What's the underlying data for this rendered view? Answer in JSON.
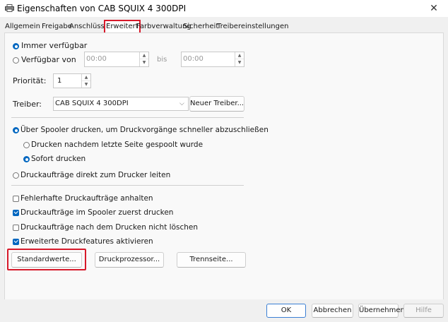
{
  "window": {
    "title": "Eigenschaften von CAB SQUIX 4 300DPI",
    "close_glyph": "✕"
  },
  "tabs": [
    {
      "label": "Allgemein"
    },
    {
      "label": "Freigabe"
    },
    {
      "label": "Anschlüsse"
    },
    {
      "label": "Erweitert"
    },
    {
      "label": "Farbverwaltung"
    },
    {
      "label": "Sicherheit"
    },
    {
      "label": "Treibereinstellungen"
    }
  ],
  "active_tab": "Erweitert",
  "availability": {
    "always_label": "Immer verfügbar",
    "from_label": "Verfügbar von",
    "from_time": "00:00",
    "bis_label": "bis",
    "to_time": "00:00",
    "selected": "always"
  },
  "priority": {
    "label": "Priorität:",
    "value": "1"
  },
  "driver": {
    "label": "Treiber:",
    "value": "CAB SQUIX 4 300DPI",
    "new_button": "Neuer Treiber..."
  },
  "spooling": {
    "spool_label": "Über Spooler drucken, um Druckvorgänge schneller abzuschließen",
    "after_last_page_label": "Drucken nachdem letzte Seite gespoolt wurde",
    "immediately_label": "Sofort drucken",
    "direct_label": "Druckaufträge direkt zum Drucker leiten",
    "selected_mode": "spool",
    "selected_start": "immediately"
  },
  "options": [
    {
      "label": "Fehlerhafte Druckaufträge anhalten",
      "checked": false
    },
    {
      "label": "Druckaufträge im Spooler zuerst drucken",
      "checked": true
    },
    {
      "label": "Druckaufträge nach dem Drucken nicht löschen",
      "checked": false
    },
    {
      "label": "Erweiterte Druckfeatures aktivieren",
      "checked": true
    }
  ],
  "buttons": {
    "defaults": "Standardwerte...",
    "processor": "Druckprozessor...",
    "separator": "Trennseite..."
  },
  "footer": {
    "ok": "OK",
    "cancel": "Abbrechen",
    "apply": "Übernehmen",
    "help": "Hilfe"
  },
  "colors": {
    "accent": "#0067c0",
    "highlight": "#d7192a"
  }
}
